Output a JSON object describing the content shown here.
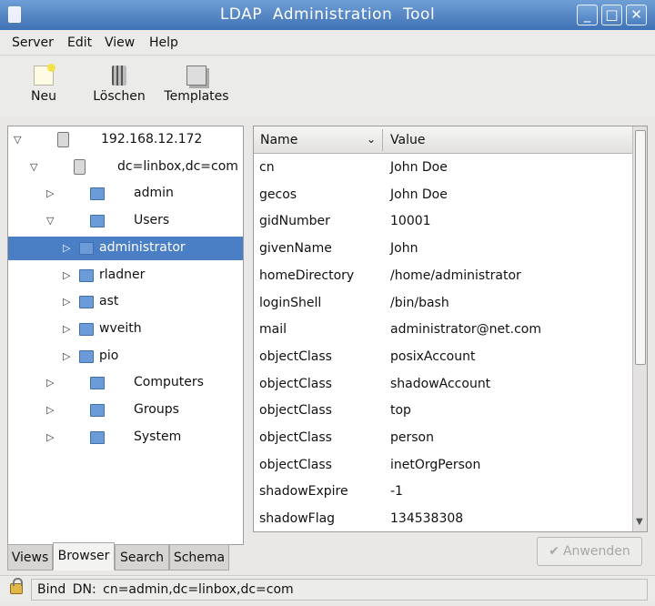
{
  "window": {
    "title": "LDAP Administration Tool",
    "buttons": {
      "minimize": "_",
      "maximize": "□",
      "close": "✕"
    }
  },
  "menu": [
    "Server",
    "Edit",
    "View",
    "Help"
  ],
  "toolbar": {
    "new_label": "Neu",
    "delete_label": "Löschen",
    "templates_label": "Templates"
  },
  "tree": [
    {
      "label": "192.168.12.172",
      "icon": "server-icon",
      "expander": "▽",
      "depth": 0
    },
    {
      "label": "dc=linbox,dc=com",
      "icon": "server-icon",
      "expander": "▽",
      "depth": 1
    },
    {
      "label": "admin",
      "icon": "folder-icon",
      "expander": "▷",
      "depth": 2
    },
    {
      "label": "Users",
      "icon": "folder-icon",
      "expander": "▽",
      "depth": 2
    },
    {
      "label": "administrator",
      "icon": "folder-icon",
      "expander": "▷",
      "depth": 3,
      "selected": true
    },
    {
      "label": "rladner",
      "icon": "folder-icon",
      "expander": "▷",
      "depth": 3
    },
    {
      "label": "ast",
      "icon": "folder-icon",
      "expander": "▷",
      "depth": 3
    },
    {
      "label": "wveith",
      "icon": "folder-icon",
      "expander": "▷",
      "depth": 3
    },
    {
      "label": "pio",
      "icon": "folder-icon",
      "expander": "▷",
      "depth": 3
    },
    {
      "label": "Computers",
      "icon": "folder-icon",
      "expander": "▷",
      "depth": 2
    },
    {
      "label": "Groups",
      "icon": "folder-icon",
      "expander": "▷",
      "depth": 2
    },
    {
      "label": "System",
      "icon": "folder-icon",
      "expander": "▷",
      "depth": 2
    }
  ],
  "left_tabs": [
    {
      "label": "Views",
      "active": false
    },
    {
      "label": "Browser",
      "active": true
    },
    {
      "label": "Search",
      "active": false
    },
    {
      "label": "Schema",
      "active": false
    }
  ],
  "attributes": {
    "header": {
      "name": "Name",
      "value": "Value"
    },
    "rows": [
      {
        "name": "cn",
        "value": "John  Doe"
      },
      {
        "name": "gecos",
        "value": "John  Doe"
      },
      {
        "name": "gidNumber",
        "value": "10001"
      },
      {
        "name": "givenName",
        "value": "John"
      },
      {
        "name": "homeDirectory",
        "value": "/home/administrator"
      },
      {
        "name": "loginShell",
        "value": "/bin/bash"
      },
      {
        "name": "mail",
        "value": "administrator@net.com"
      },
      {
        "name": "objectClass",
        "value": "posixAccount"
      },
      {
        "name": "objectClass",
        "value": "shadowAccount"
      },
      {
        "name": "objectClass",
        "value": "top"
      },
      {
        "name": "objectClass",
        "value": "person"
      },
      {
        "name": "objectClass",
        "value": "inetOrgPerson"
      },
      {
        "name": "shadowExpire",
        "value": "-1"
      },
      {
        "name": "shadowFlag",
        "value": "134538308"
      }
    ]
  },
  "apply_button": "Anwenden",
  "status": {
    "bind_dn": "Bind  DN:  cn=admin,dc=linbox,dc=com"
  },
  "colors": {
    "accent": "#4a7ec5",
    "titlebar": "#3f72b5"
  }
}
